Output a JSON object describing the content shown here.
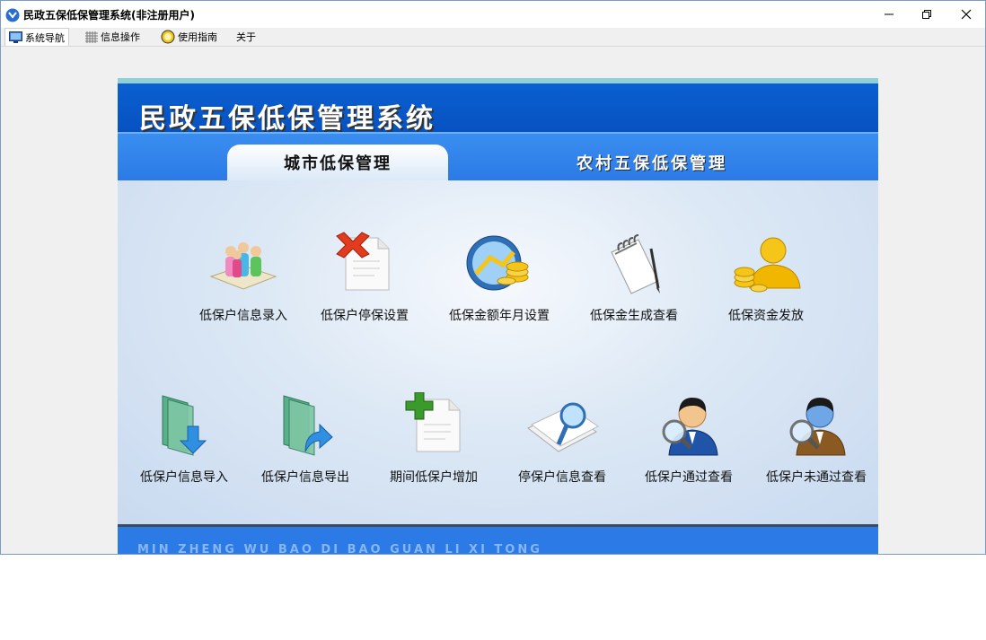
{
  "window": {
    "title": "民政五保低保管理系统(非注册用户)"
  },
  "menu": [
    {
      "label": "系统导航",
      "icon": "monitor-icon"
    },
    {
      "label": "信息操作",
      "icon": "grid-icon"
    },
    {
      "label": "使用指南",
      "icon": "help-icon"
    },
    {
      "label": "关于",
      "icon": ""
    }
  ],
  "banner": {
    "title": "民政五保低保管理系统"
  },
  "tabs": [
    {
      "label": "城市低保管理"
    },
    {
      "label": "农村五保低保管理"
    }
  ],
  "row1": [
    {
      "label": "低保户信息录入",
      "icon": "people-icon"
    },
    {
      "label": "低保户停保设置",
      "icon": "document-delete-icon"
    },
    {
      "label": "低保金额年月设置",
      "icon": "money-settings-icon"
    },
    {
      "label": "低保金生成查看",
      "icon": "notepad-icon"
    },
    {
      "label": "低保资金发放",
      "icon": "coins-user-icon"
    }
  ],
  "row2": [
    {
      "label": "低保户信息导入",
      "icon": "folder-import-icon"
    },
    {
      "label": "低保户信息导出",
      "icon": "folder-export-icon"
    },
    {
      "label": "期间低保户增加",
      "icon": "document-add-icon"
    },
    {
      "label": "停保户信息查看",
      "icon": "document-search-icon"
    },
    {
      "label": "低保户通过查看",
      "icon": "user-search-blue-icon"
    },
    {
      "label": "低保户未通过查看",
      "icon": "user-search-brown-icon"
    }
  ],
  "footer": {
    "text": "MIN ZHENG WU BAO DI BAO GUAN LI XI TONG"
  },
  "colors": {
    "banner": "#0752c2",
    "tabbar": "#2b7ae6",
    "content": "#c9daf0"
  }
}
